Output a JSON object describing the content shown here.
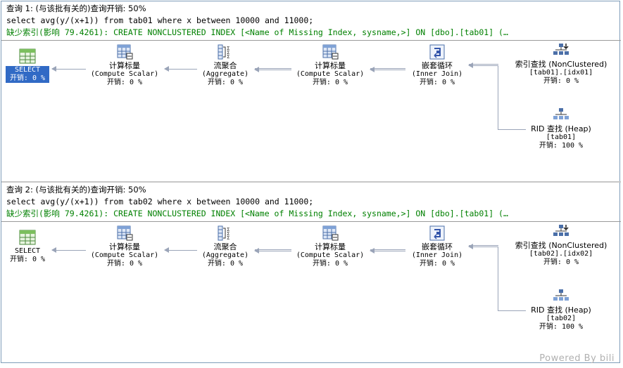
{
  "queries": [
    {
      "title": "查询 1: (与该批有关的)查询开销: 50%",
      "sql": "select avg(y/(x+1)) from tab01 where x between 10000 and 11000;",
      "missing_index": "缺少索引(影响 79.4261): CREATE NONCLUSTERED INDEX [<Name of Missing Index, sysname,>] ON [dbo].[tab01] (…",
      "nodes": {
        "select": {
          "label": "SELECT",
          "cost": "开销: 0 %"
        },
        "compute1": {
          "label": "计算标量",
          "sub": "(Compute Scalar)",
          "cost": "开销: 0 %"
        },
        "aggregate": {
          "label": "流聚合",
          "sub": "(Aggregate)",
          "cost": "开销: 0 %"
        },
        "compute2": {
          "label": "计算标量",
          "sub": "(Compute Scalar)",
          "cost": "开销: 0 %"
        },
        "nested": {
          "label": "嵌套循环",
          "sub": "(Inner Join)",
          "cost": "开销: 0 %"
        },
        "seek": {
          "label": "索引查找 (NonClustered)",
          "sub": "[tab01].[idx01]",
          "cost": "开销: 0 %"
        },
        "rid": {
          "label": "RID 查找 (Heap)",
          "sub": "[tab01]",
          "cost": "开销: 100 %"
        }
      }
    },
    {
      "title": "查询 2: (与该批有关的)查询开销: 50%",
      "sql": "select avg(y/(x+1)) from tab02 where x between 10000 and 11000;",
      "missing_index": "缺少索引(影响 79.4261): CREATE NONCLUSTERED INDEX [<Name of Missing Index, sysname,>] ON [dbo].[tab01] (…",
      "nodes": {
        "select": {
          "label": "SELECT",
          "cost": "开销: 0 %"
        },
        "compute1": {
          "label": "计算标量",
          "sub": "(Compute Scalar)",
          "cost": "开销: 0 %"
        },
        "aggregate": {
          "label": "流聚合",
          "sub": "(Aggregate)",
          "cost": "开销: 0 %"
        },
        "compute2": {
          "label": "计算标量",
          "sub": "(Compute Scalar)",
          "cost": "开销: 0 %"
        },
        "nested": {
          "label": "嵌套循环",
          "sub": "(Inner Join)",
          "cost": "开销: 0 %"
        },
        "seek": {
          "label": "索引查找 (NonClustered)",
          "sub": "[tab02].[idx02]",
          "cost": "开销: 0 %"
        },
        "rid": {
          "label": "RID 查找 (Heap)",
          "sub": "[tab02]",
          "cost": "开销: 100 %"
        }
      }
    }
  ],
  "watermark": "Powered By bili"
}
